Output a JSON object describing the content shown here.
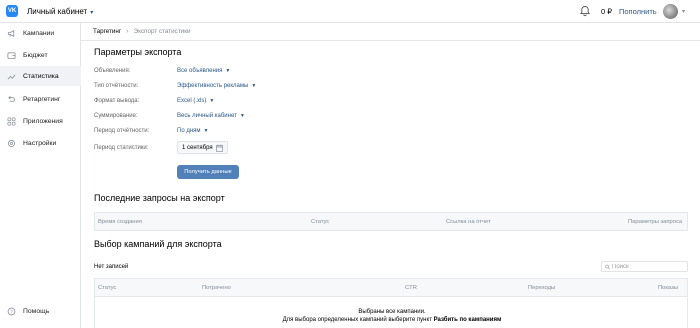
{
  "header": {
    "logo_text": "VK",
    "cabinet_label": "Личный кабинет",
    "balance": "0 ₽",
    "topup_label": "Пополнить"
  },
  "sidebar": {
    "items": [
      {
        "label": "Кампании",
        "icon": "megaphone-icon"
      },
      {
        "label": "Бюджет",
        "icon": "wallet-icon"
      },
      {
        "label": "Статистика",
        "icon": "chart-icon",
        "active": true
      },
      {
        "label": "Ретаргетинг",
        "icon": "retarget-icon"
      },
      {
        "label": "Приложения",
        "icon": "apps-icon"
      },
      {
        "label": "Настройки",
        "icon": "gear-icon"
      }
    ],
    "help_label": "Помощь"
  },
  "breadcrumb": {
    "parent": "Таргетинг",
    "separator": "›",
    "current": "Экспорт статистики"
  },
  "export_params": {
    "title": "Параметры экспорта",
    "rows": [
      {
        "label": "Объявления:",
        "value": "Все объявления"
      },
      {
        "label": "Тип отчётности:",
        "value": "Эффективность рекламы"
      },
      {
        "label": "Формат вывода:",
        "value": "Excel (.xls)"
      },
      {
        "label": "Суммирование:",
        "value": "Весь личный кабинет"
      },
      {
        "label": "Период отчётности:",
        "value": "По дням"
      }
    ],
    "stat_period_label": "Период статистики:",
    "stat_period_value": "1 сентября",
    "get_button": "Получить данные"
  },
  "recent_requests": {
    "title": "Последние запросы на экспорт",
    "columns": [
      "Время создания",
      "Статус",
      "Ссылка на отчет",
      "Параметры запроса"
    ]
  },
  "campaign_select": {
    "title": "Выбор кампаний для экспорта",
    "no_records": "Нет записей",
    "search_placeholder": "Поиск",
    "columns": [
      "Статус",
      "Потрачено",
      "CTR",
      "Переходы",
      "Показы"
    ],
    "empty_line1": "Выбраны все кампании.",
    "empty_line2_prefix": "Для выбора определенных кампаний выберите пункт",
    "empty_line2_bold": "Разбить по кампаниям"
  },
  "colors": {
    "accent": "#5181b8",
    "link": "#2a5885",
    "brand": "#2787f5"
  }
}
